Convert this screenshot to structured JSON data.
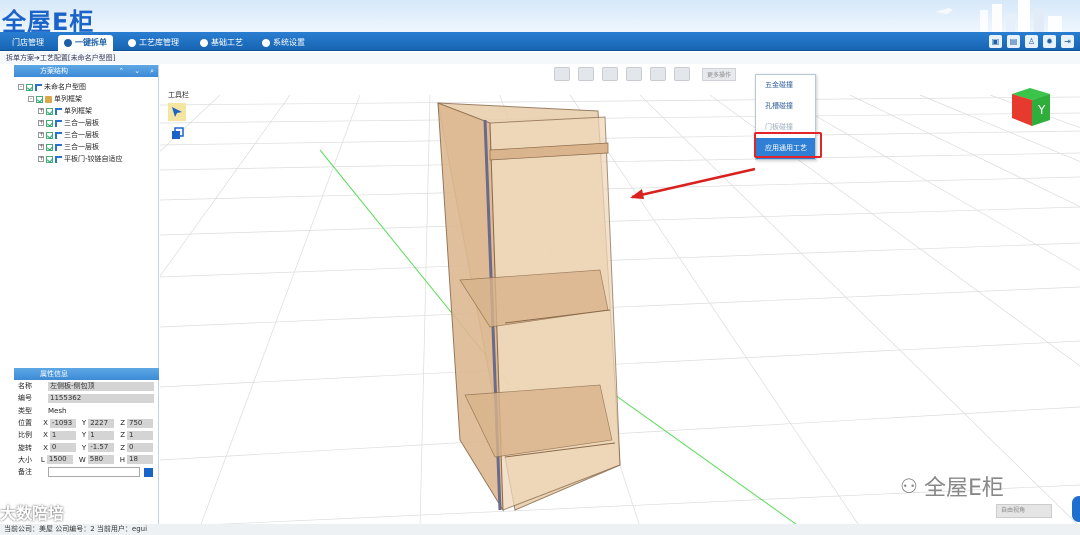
{
  "header": {
    "logo_text": "全屋E柜"
  },
  "nav": {
    "tabs": [
      {
        "label": "门店管理"
      },
      {
        "label": "一键拆单"
      },
      {
        "label": "工艺库管理"
      },
      {
        "label": "基础工艺"
      },
      {
        "label": "系统设置"
      }
    ]
  },
  "breadcrumb": "拆单方案➔工艺配置[未命名户型图]",
  "scheme_panel": {
    "title": "方案结构",
    "tree": [
      {
        "label": "未命名户型图"
      },
      {
        "label": "单列框架"
      },
      {
        "label": "单列框架"
      },
      {
        "label": "三合一层板"
      },
      {
        "label": "三合一层板"
      },
      {
        "label": "三合一层板"
      },
      {
        "label": "平板门-铰链自适应"
      }
    ]
  },
  "toolbox": {
    "label": "工具栏"
  },
  "top_toolbar": {
    "more_label": "更多操作"
  },
  "context_menu": {
    "items": [
      "五金碰撞",
      "孔槽碰撞",
      "门板碰撞",
      "应用通用工艺"
    ],
    "highlighted": "应用通用工艺"
  },
  "view_cube_label": "Y",
  "props_panel": {
    "title": "属性信息",
    "name_label": "名称",
    "name_value": "左侧板-侧包顶",
    "code_label": "编号",
    "code_value": "1155362",
    "type_label": "类型",
    "type_value": "Mesh",
    "pos_label": "位置",
    "pos": {
      "x": "-1093",
      "y": "2227",
      "z": "750"
    },
    "scale_label": "比例",
    "scale": {
      "x": "1",
      "y": "1",
      "z": "1"
    },
    "rot_label": "旋转",
    "rot": {
      "x": "0",
      "y": "-1.57",
      "z": "0"
    },
    "size_label": "大小",
    "size": {
      "l": "1500",
      "w": "580",
      "h": "18"
    },
    "note_label": "备注",
    "note_value": ""
  },
  "axis_letters": {
    "x": "X",
    "y": "Y",
    "z": "Z",
    "l": "L",
    "w": "W",
    "h": "H"
  },
  "view_select": "自由视角",
  "status_bar": "当前公司：美屋   公司编号：2   当前用户：egui",
  "watermarks": {
    "left": "大数陪培",
    "right": "全屋E柜"
  }
}
